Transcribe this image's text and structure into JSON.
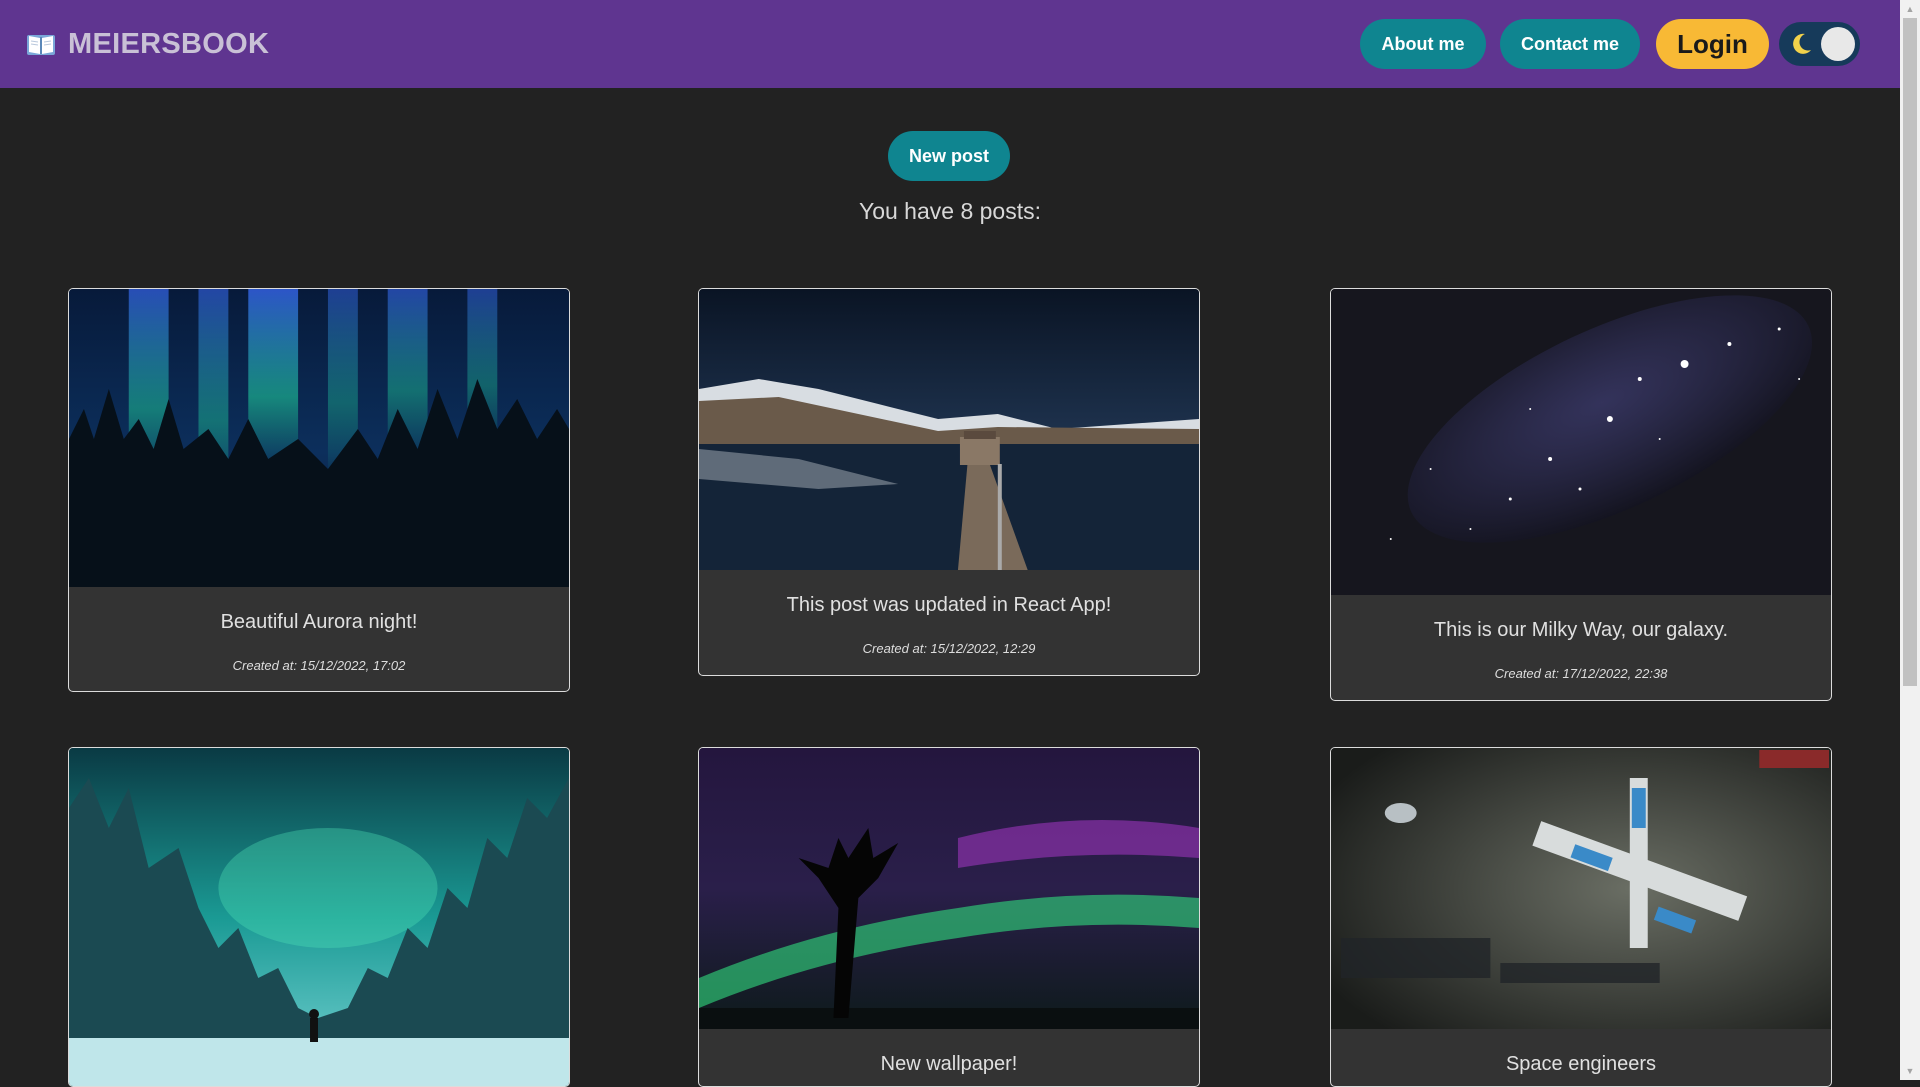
{
  "navbar": {
    "brand": "MEIERSBOOK",
    "about_label": "About me",
    "contact_label": "Contact me",
    "login_label": "Login",
    "brand_color": "#5f3590",
    "accent_color": "#0f8590",
    "login_color": "#f8b935"
  },
  "main": {
    "new_post_label": "New post",
    "post_count_text": "You have 8 posts:"
  },
  "posts": [
    {
      "title": "Beautiful Aurora night!",
      "created": "Created at: 15/12/2022, 17:02",
      "image": "aurora-forest"
    },
    {
      "title": "This post was updated in React App!",
      "created": "Created at: 15/12/2022, 12:29",
      "image": "lake-pier-night"
    },
    {
      "title": "This is our Milky Way, our galaxy.",
      "created": "Created at: 17/12/2022, 22:38",
      "image": "galaxy-stars"
    },
    {
      "title": "",
      "created": "",
      "image": "aurora-snow-forest"
    },
    {
      "title": "New wallpaper!",
      "created": "",
      "image": "aurora-tree-silhouette"
    },
    {
      "title": "Space engineers",
      "created": "",
      "image": "space-station"
    }
  ]
}
